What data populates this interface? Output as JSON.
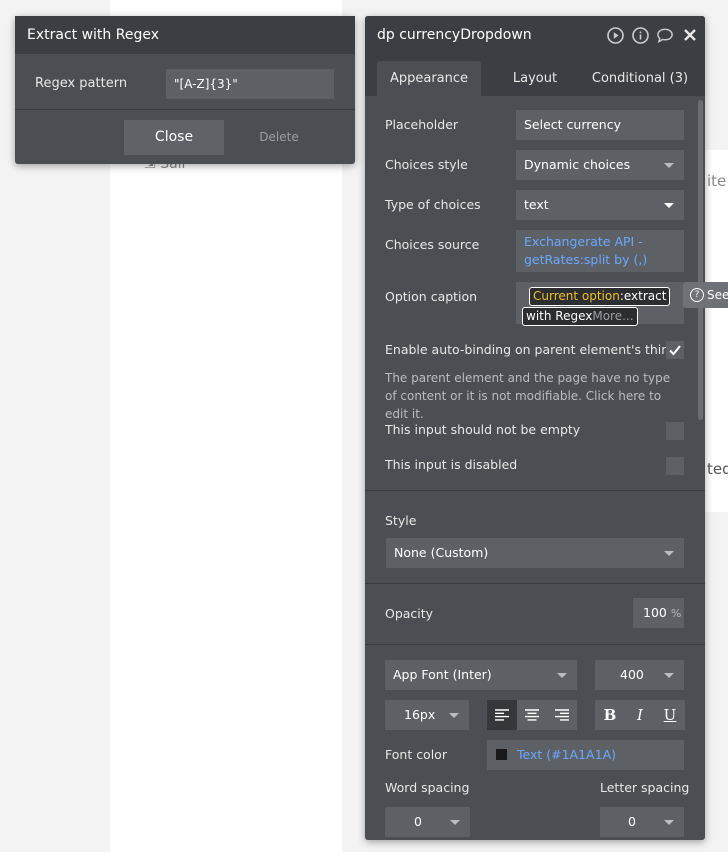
{
  "canvas": {
    "text_sall": "Sall",
    "text_ite": "ite c",
    "text_ted": "ted"
  },
  "regex_panel": {
    "title": "Extract with Regex",
    "pattern_label": "Regex pattern",
    "pattern_value": "\"[A-Z]{3}\"",
    "close_label": "Close",
    "delete_label": "Delete"
  },
  "main_panel": {
    "title": "dp currencyDropdown",
    "icons": [
      "play-icon",
      "info-icon",
      "comment-icon",
      "close-icon"
    ],
    "tabs": [
      {
        "label": "Appearance",
        "active": true
      },
      {
        "label": "Layout",
        "active": false
      },
      {
        "label": "Conditional (3)",
        "active": false
      }
    ],
    "placeholder": {
      "label": "Placeholder",
      "value": "Select currency"
    },
    "choices_style": {
      "label": "Choices style",
      "value": "Dynamic choices"
    },
    "type_of_choices": {
      "label": "Type of choices",
      "value": "text"
    },
    "choices_source": {
      "label": "Choices source",
      "value": "Exchangerate API - getRates:split by (,)"
    },
    "option_caption": {
      "label": "Option caption",
      "dynamic_part": "Current option",
      "op_part": ":extract",
      "line2": "with Regex",
      "more": "More..."
    },
    "see_label": "See",
    "auto_binding": {
      "label": "Enable auto-binding on parent element's thing",
      "checked": true
    },
    "hint_text": "The parent element and the page have no type of content or it is not modifiable. Click here to edit it.",
    "not_empty": {
      "label": "This input should not be empty",
      "checked": false
    },
    "disabled": {
      "label": "This input is disabled",
      "checked": false
    },
    "style": {
      "label": "Style",
      "value": "None (Custom)"
    },
    "opacity": {
      "label": "Opacity",
      "value": "100",
      "unit": "%"
    },
    "font_family": "App Font (Inter)",
    "font_weight": "400",
    "font_size": "16px",
    "alignment_selected": "left",
    "format_buttons": [
      "B",
      "I",
      "U"
    ],
    "font_color": {
      "label": "Font color",
      "value": "Text (#1A1A1A)",
      "swatch": "#1A1A1A"
    },
    "word_spacing": {
      "label": "Word spacing",
      "value": "0"
    },
    "letter_spacing": {
      "label": "Letter spacing",
      "value": "0"
    }
  },
  "colors": {
    "panel_bg": "#4b4e52",
    "header_bg": "#3b3e42",
    "field_bg": "#5d6166",
    "link_blue": "#6aa8ff",
    "dynamic_yellow": "#f0c020"
  }
}
